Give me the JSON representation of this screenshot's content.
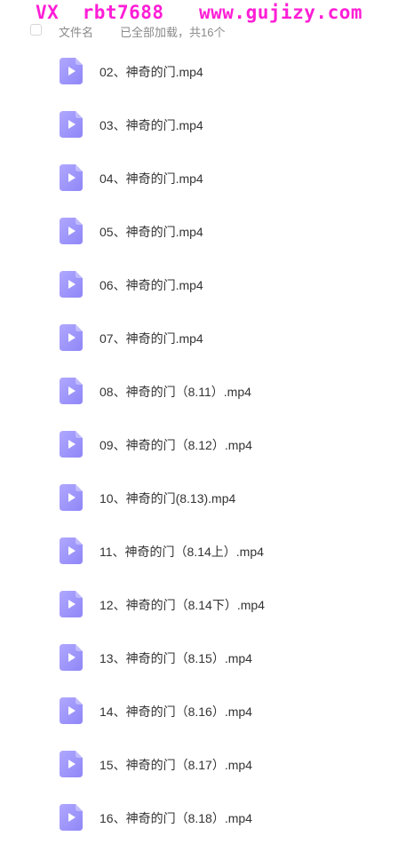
{
  "watermark": "VX  rbt7688   www.gujizy.com",
  "header": {
    "column_name": "文件名",
    "status": "已全部加载，共16个"
  },
  "colors": {
    "watermark": "#ff1ed6",
    "video_icon_start": "#b0a8ff",
    "video_icon_end": "#8f86f7"
  },
  "file_icon": "video-file-icon",
  "files": [
    "02、神奇的门.mp4",
    "03、神奇的门.mp4",
    "04、神奇的门.mp4",
    "05、神奇的门.mp4",
    "06、神奇的门.mp4",
    "07、神奇的门.mp4",
    "08、神奇的门（8.11）.mp4",
    "09、神奇的门（8.12）.mp4",
    "10、神奇的门(8.13).mp4",
    "11、神奇的门（8.14上）.mp4",
    "12、神奇的门（8.14下）.mp4",
    "13、神奇的门（8.15）.mp4",
    "14、神奇的门（8.16）.mp4",
    "15、神奇的门（8.17）.mp4",
    "16、神奇的门（8.18）.mp4"
  ]
}
